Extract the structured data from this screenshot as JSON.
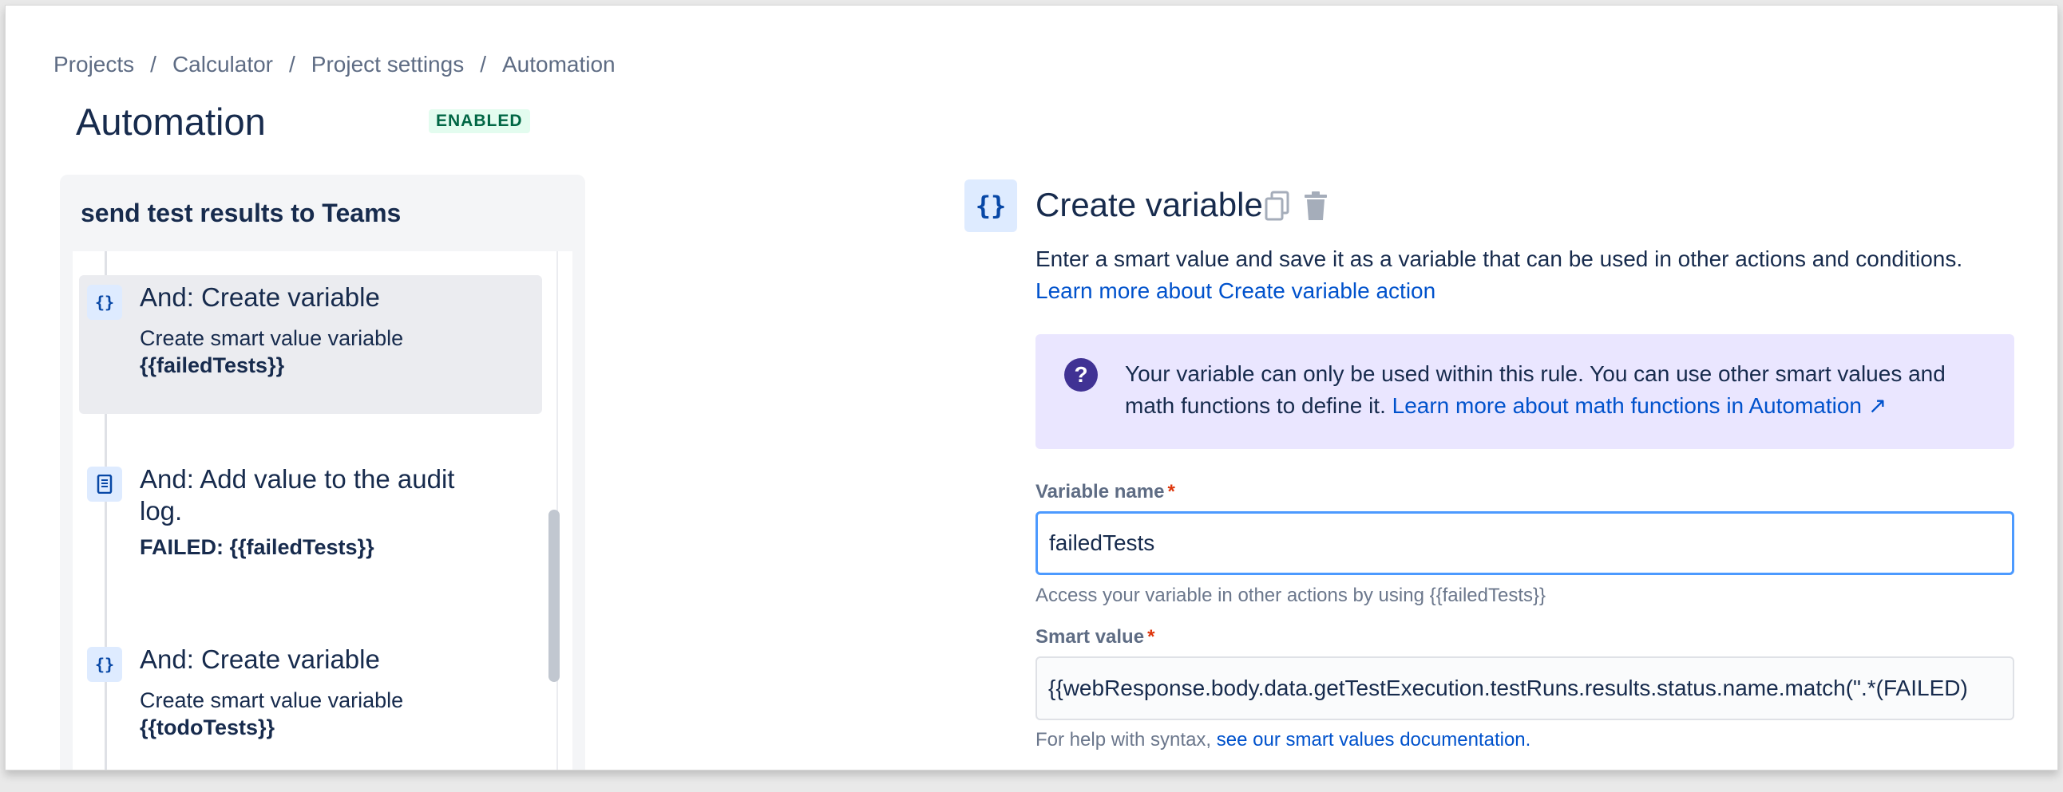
{
  "breadcrumb": {
    "items": [
      "Projects",
      "Calculator",
      "Project settings",
      "Automation"
    ],
    "separator": "/"
  },
  "page": {
    "title": "Automation",
    "status_badge": "ENABLED"
  },
  "rule": {
    "name": "send test results to Teams",
    "steps": [
      {
        "icon": "curly-braces-icon",
        "icon_glyph": "{}",
        "heading": "And: Create variable",
        "desc_line1": "Create smart value variable",
        "desc_bold": "{{failedTests}}",
        "selected": true
      },
      {
        "icon": "audit-log-icon",
        "heading": "And: Add value to the audit log.",
        "desc_bold": "FAILED: {{failedTests}}",
        "selected": false
      },
      {
        "icon": "curly-braces-icon",
        "icon_glyph": "{}",
        "heading": "And: Create variable",
        "desc_line1": "Create smart value variable",
        "desc_bold": "{{todoTests}}",
        "selected": false
      }
    ]
  },
  "detail": {
    "icon": "curly-braces-icon",
    "icon_glyph": "{}",
    "title": "Create variable",
    "description": "Enter a smart value and save it as a variable that can be used in other actions and conditions.",
    "learn_more": "Learn more about Create variable action",
    "info": {
      "icon_glyph": "?",
      "text": "Your variable can only be used within this rule. You can use other smart values and math functions to define it.",
      "link": "Learn more about math functions in Automation ↗"
    },
    "variable_name": {
      "label": "Variable name",
      "required_mark": "*",
      "value": "failedTests",
      "helper": "Access your variable in other actions by using {{failedTests}}"
    },
    "smart_value": {
      "label": "Smart value",
      "required_mark": "*",
      "value": "{{webResponse.body.data.getTestExecution.testRuns.results.status.name.match(\".*(FAILED)",
      "helper_prefix": "For help with syntax,",
      "helper_link": "see our smart values documentation."
    }
  },
  "colors": {
    "link": "#0052cc",
    "badge_bg": "#e3fcef",
    "badge_text": "#006644",
    "info_bg": "#eae6ff",
    "info_icon": "#403294",
    "focus_border": "#4c9aff",
    "required": "#de350b"
  }
}
